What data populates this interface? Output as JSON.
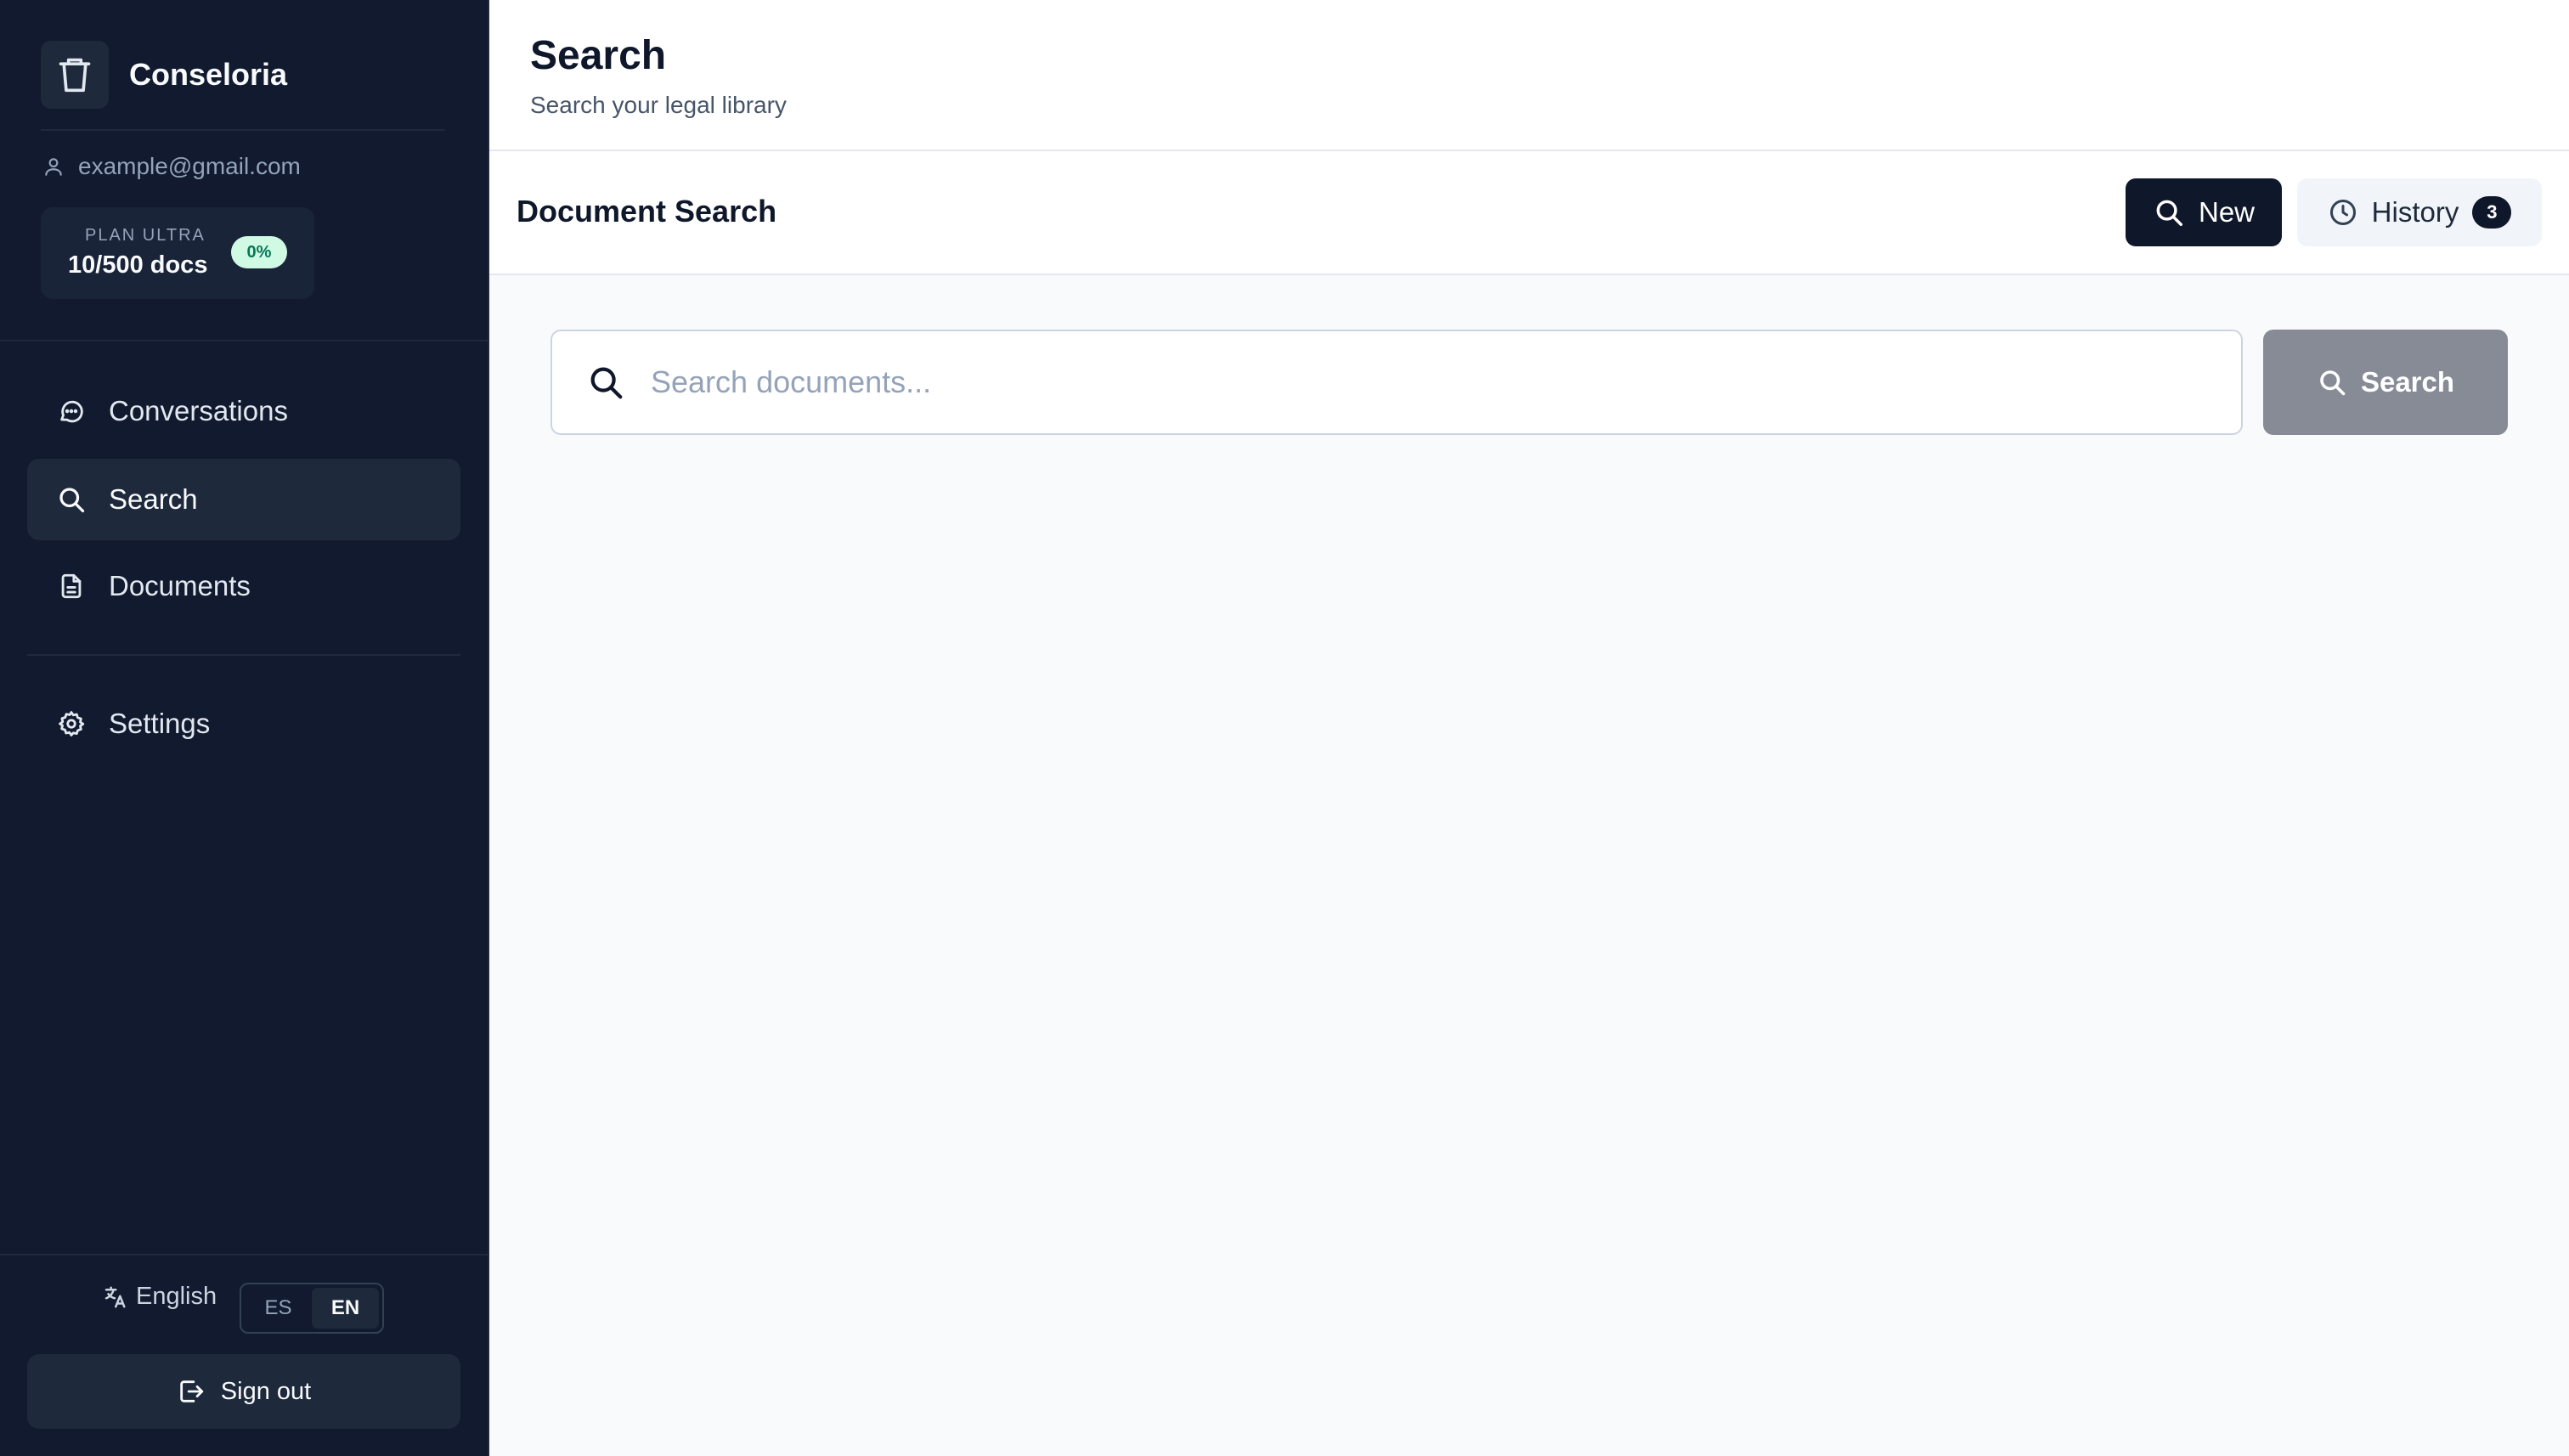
{
  "app": {
    "name": "Conseloria"
  },
  "user": {
    "email": "example@gmail.com"
  },
  "plan": {
    "label": "PLAN ULTRA",
    "usage": "10/500 docs",
    "percent": "0%"
  },
  "sidebar": {
    "items": [
      {
        "label": "Conversations",
        "icon": "chat-icon"
      },
      {
        "label": "Search",
        "icon": "search-icon",
        "active": true
      },
      {
        "label": "Documents",
        "icon": "document-icon"
      },
      {
        "label": "Settings",
        "icon": "gear-icon"
      }
    ]
  },
  "language": {
    "current": "English",
    "options": [
      "ES",
      "EN"
    ],
    "selected": "EN"
  },
  "signout": {
    "label": "Sign out"
  },
  "header": {
    "title": "Search",
    "subtitle": "Search your legal library"
  },
  "toolbar": {
    "title": "Document Search",
    "new_label": "New",
    "history_label": "History",
    "history_count": "3"
  },
  "search": {
    "placeholder": "Search documents...",
    "value": "",
    "button_label": "Search"
  },
  "colors": {
    "sidebar_bg": "#111a2e",
    "primary": "#0f172a",
    "search_button_disabled": "#868b96",
    "badge_green_bg": "#d1fae5"
  }
}
